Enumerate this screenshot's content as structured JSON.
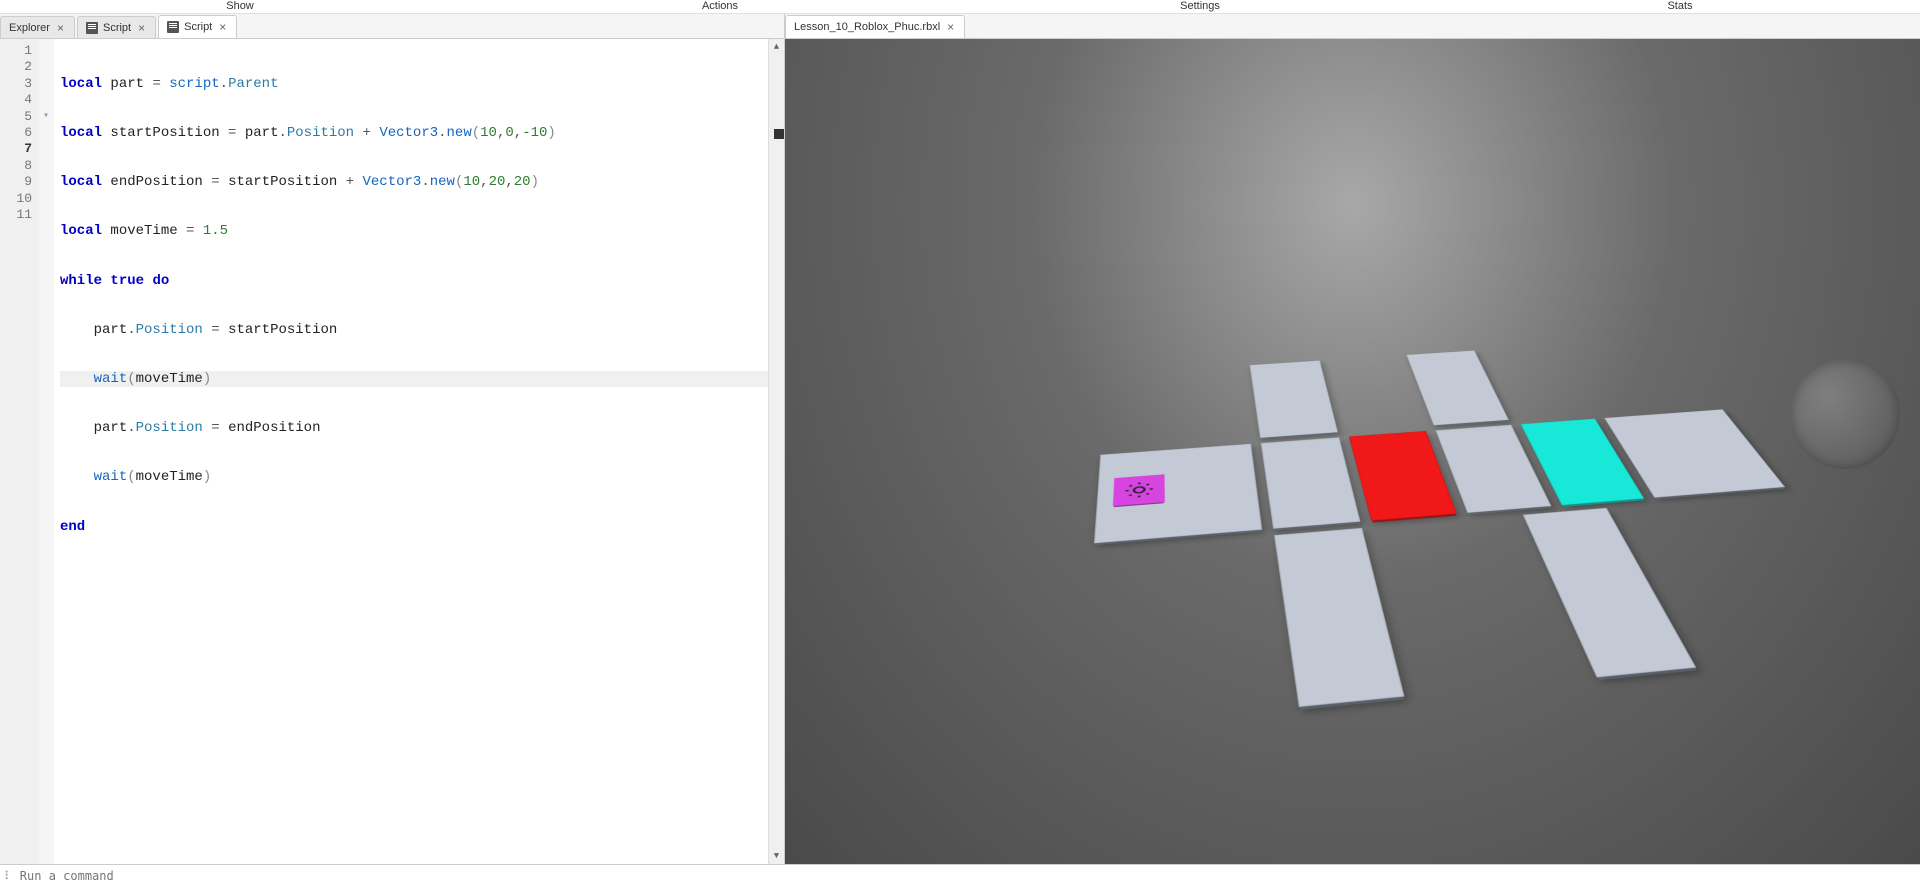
{
  "menu": {
    "show": "Show",
    "actions": "Actions",
    "settings": "Settings",
    "stats": "Stats"
  },
  "leftTabs": {
    "t0": {
      "label": "Explorer"
    },
    "t1": {
      "label": "Script"
    },
    "t2": {
      "label": "Script"
    }
  },
  "rightTabs": {
    "t0": {
      "label": "Lesson_10_Roblox_Phuc.rbxl"
    }
  },
  "lineNumbers": [
    "1",
    "2",
    "3",
    "4",
    "5",
    "6",
    "7",
    "8",
    "9",
    "10",
    "11"
  ],
  "currentLine": 7,
  "code": {
    "l1": {
      "kw1": "local",
      "id": "part",
      "eq": "=",
      "sc": "script",
      "dot": ".",
      "pr": "Parent"
    },
    "l2": {
      "kw1": "local",
      "id": "startPosition",
      "eq": "=",
      "p": "part",
      "dot": ".",
      "pr": "Position",
      "plus": "+",
      "ty": "Vector3",
      "dot2": ".",
      "fn": "new",
      "a": "10",
      "b": "0",
      "c": "-10"
    },
    "l3": {
      "kw1": "local",
      "id": "endPosition",
      "eq": "=",
      "sp": "startPosition",
      "plus": "+",
      "ty": "Vector3",
      "dot2": ".",
      "fn": "new",
      "a": "10",
      "b": "20",
      "c": "20"
    },
    "l4": {
      "kw1": "local",
      "id": "moveTime",
      "eq": "=",
      "n": "1.5"
    },
    "l5": {
      "kw1": "while",
      "kw2": "true",
      "kw3": "do"
    },
    "l6": {
      "p": "part",
      "dot": ".",
      "pr": "Position",
      "eq": "=",
      "sp": "startPosition"
    },
    "l7": {
      "fn": "wait",
      "arg": "moveTime"
    },
    "l8": {
      "p": "part",
      "dot": ".",
      "pr": "Position",
      "eq": "=",
      "ep": "endPosition"
    },
    "l9": {
      "fn": "wait",
      "arg": "moveTime"
    },
    "l10": {
      "kw": "end"
    }
  },
  "command": {
    "placeholder": "Run a command"
  }
}
